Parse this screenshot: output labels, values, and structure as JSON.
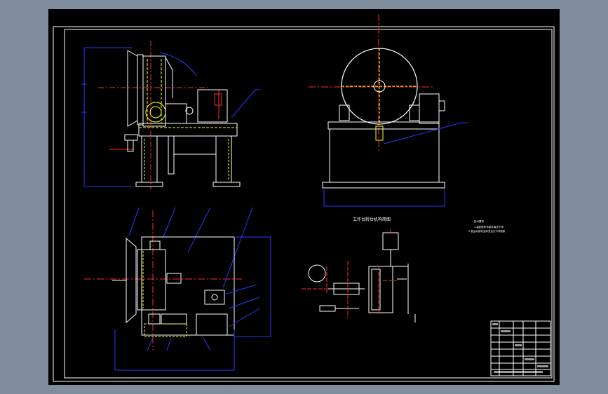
{
  "viewport": {
    "background_color": "#7f8d9c",
    "canvas_color": "#000000",
    "colors": {
      "frame": "#ffffff",
      "geometry": "#ffffff",
      "centerline": "#ff2a2a",
      "dimension": "#2a36ff",
      "hidden_line": "#ffff00",
      "accent": "#00d8ff"
    }
  },
  "drawing": {
    "views": [
      {
        "id": "side-view"
      },
      {
        "id": "front-view"
      },
      {
        "id": "top-view"
      },
      {
        "id": "schematic"
      }
    ],
    "schematic_title": "工作台转台机构简图",
    "notes": [
      "技术要求",
      "1.装配前所有零件清洗干净",
      "2.各运动部件运转灵活无卡滞现象"
    ],
    "title_block": {
      "rows": 8,
      "columns": 5
    }
  }
}
